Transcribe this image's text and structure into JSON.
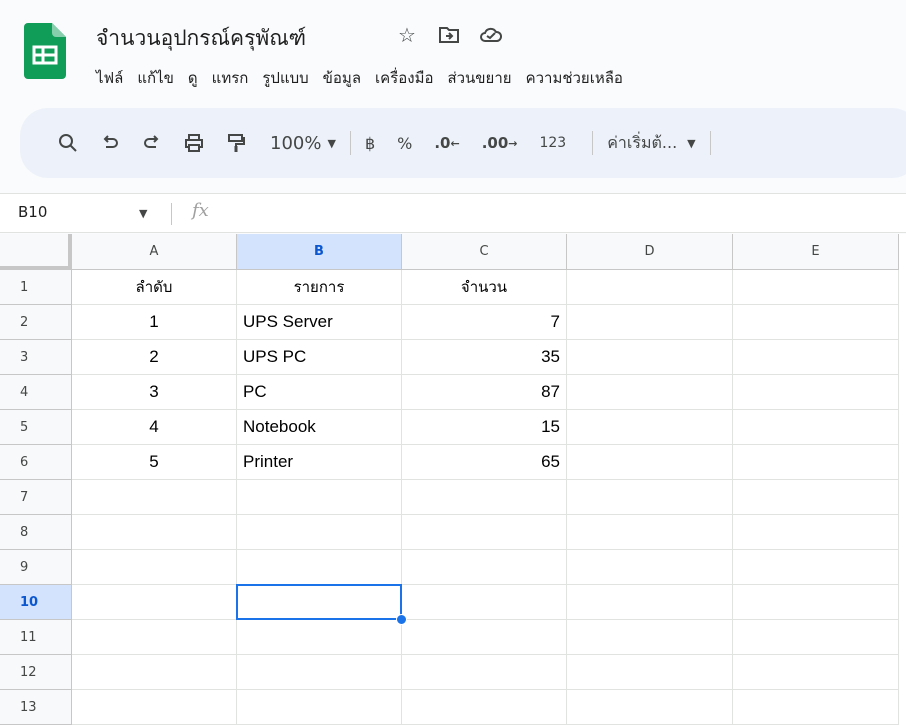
{
  "document": {
    "title": "จำนวนอุปกรณ์ครุพัณฑ์"
  },
  "title_icons": [
    "star-icon",
    "move-to-folder-icon",
    "cloud-status-icon"
  ],
  "menubar": {
    "items": [
      "ไฟล์",
      "แก้ไข",
      "ดู",
      "แทรก",
      "รูปแบบ",
      "ข้อมูล",
      "เครื่องมือ",
      "ส่วนขยาย",
      "ความช่วยเหลือ"
    ]
  },
  "toolbar": {
    "zoom": "100%",
    "currency": "฿",
    "percent": "%",
    "decrease_decimal": ".0",
    "increase_decimal": ".00",
    "number_format": "123",
    "font": "ค่าเริ่มต้...",
    "icons": [
      "search-icon",
      "undo-icon",
      "redo-icon",
      "print-icon",
      "paint-format-icon"
    ]
  },
  "formula_bar": {
    "cell_ref": "B10",
    "fx": "fx",
    "value": ""
  },
  "sheet": {
    "columns": [
      "A",
      "B",
      "C",
      "D",
      "E"
    ],
    "selected_column": "B",
    "rows": [
      "1",
      "2",
      "3",
      "4",
      "5",
      "6",
      "7",
      "8",
      "9",
      "10",
      "11",
      "12",
      "13"
    ],
    "selected_row": "10",
    "cells": [
      [
        "ลำดับ",
        "รายการ",
        "จำนวน",
        "",
        ""
      ],
      [
        "1",
        "UPS Server",
        "7",
        "",
        ""
      ],
      [
        "2",
        "UPS PC",
        "35",
        "",
        ""
      ],
      [
        "3",
        "PC",
        "87",
        "",
        ""
      ],
      [
        "4",
        "Notebook",
        "15",
        "",
        ""
      ],
      [
        "5",
        "Printer",
        "65",
        "",
        ""
      ],
      [
        "",
        "",
        "",
        "",
        ""
      ],
      [
        "",
        "",
        "",
        "",
        ""
      ],
      [
        "",
        "",
        "",
        "",
        ""
      ],
      [
        "",
        "",
        "",
        "",
        ""
      ],
      [
        "",
        "",
        "",
        "",
        ""
      ],
      [
        "",
        "",
        "",
        "",
        ""
      ],
      [
        "",
        "",
        "",
        "",
        ""
      ]
    ]
  },
  "colors": {
    "accent": "#1a73e8",
    "selected_header": "#d3e3fd",
    "sheets_green": "#0f9d58"
  }
}
